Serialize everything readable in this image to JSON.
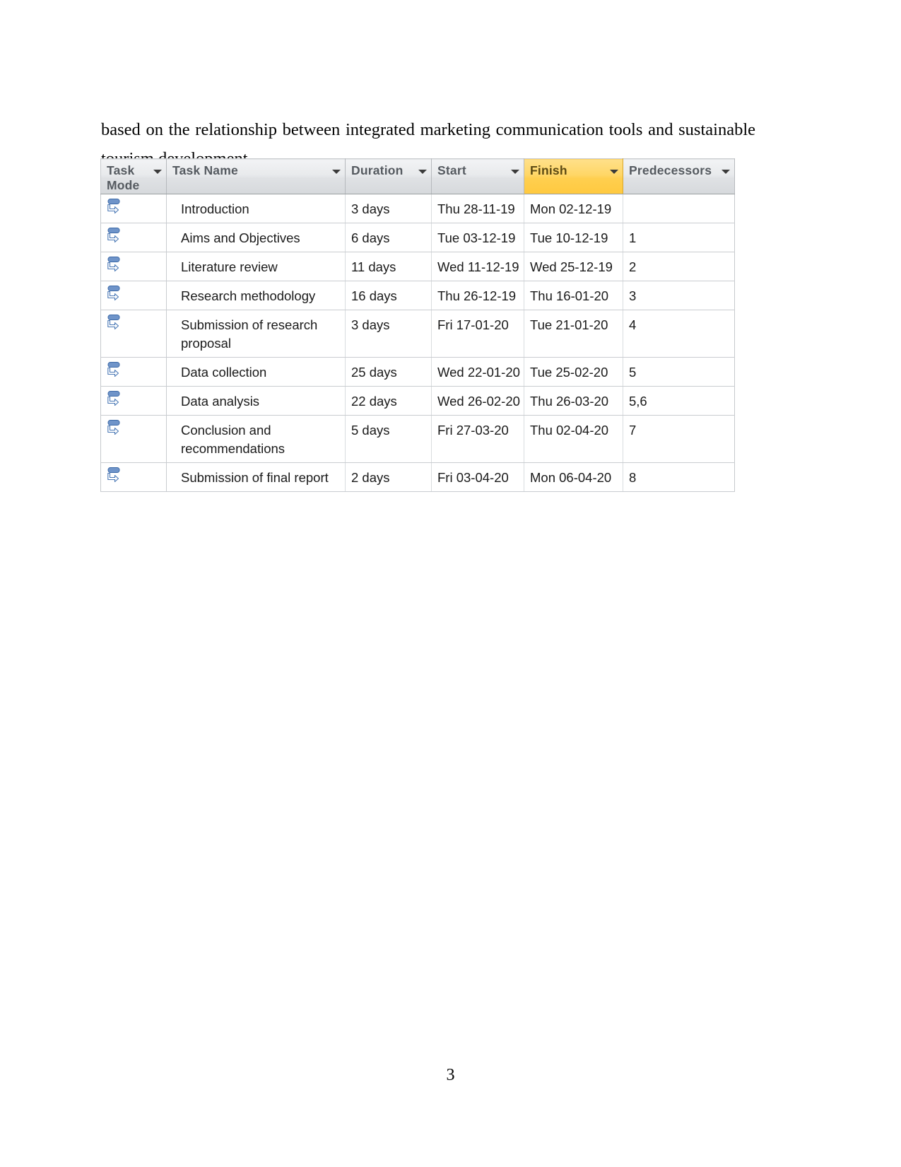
{
  "document": {
    "paragraph": "based on the relationship between integrated marketing communication tools and sustainable tourism development.",
    "page_number": "3"
  },
  "project_table": {
    "columns": [
      {
        "label": "Task\nMode",
        "key": "task_mode",
        "highlight": false,
        "caret": "chevron-down-icon"
      },
      {
        "label": "Task Name",
        "key": "task_name",
        "highlight": false,
        "caret": "chevron-down-icon"
      },
      {
        "label": "Duration",
        "key": "duration",
        "highlight": false,
        "caret": "chevron-down-icon"
      },
      {
        "label": "Start",
        "key": "start",
        "highlight": false,
        "caret": "chevron-down-icon"
      },
      {
        "label": "Finish",
        "key": "finish",
        "highlight": true,
        "caret": "chevron-down-icon"
      },
      {
        "label": "Predecessors",
        "key": "predecessors",
        "highlight": false,
        "caret": "chevron-down-icon"
      }
    ],
    "highlight_color": "#FFD666",
    "header_color": "#E4E6E9",
    "rows": [
      {
        "task_mode": "manually-scheduled-icon",
        "task_name": "Introduction",
        "duration": "3 days",
        "start": "Thu 28-11-19",
        "finish": "Mon 02-12-19",
        "predecessors": ""
      },
      {
        "task_mode": "manually-scheduled-icon",
        "task_name": "Aims and Objectives",
        "duration": "6 days",
        "start": "Tue 03-12-19",
        "finish": "Tue 10-12-19",
        "predecessors": "1"
      },
      {
        "task_mode": "manually-scheduled-icon",
        "task_name": "Literature review",
        "duration": "11 days",
        "start": "Wed 11-12-19",
        "finish": "Wed 25-12-19",
        "predecessors": "2"
      },
      {
        "task_mode": "manually-scheduled-icon",
        "task_name": "Research methodology",
        "duration": "16 days",
        "start": "Thu 26-12-19",
        "finish": "Thu 16-01-20",
        "predecessors": "3"
      },
      {
        "task_mode": "manually-scheduled-icon",
        "task_name": "Submission of research proposal",
        "duration": "3 days",
        "start": "Fri 17-01-20",
        "finish": "Tue 21-01-20",
        "predecessors": "4"
      },
      {
        "task_mode": "manually-scheduled-icon",
        "task_name": "Data collection",
        "duration": "25 days",
        "start": "Wed 22-01-20",
        "finish": "Tue 25-02-20",
        "predecessors": "5"
      },
      {
        "task_mode": "manually-scheduled-icon",
        "task_name": "Data analysis",
        "duration": "22 days",
        "start": "Wed 26-02-20",
        "finish": "Thu 26-03-20",
        "predecessors": "5,6"
      },
      {
        "task_mode": "manually-scheduled-icon",
        "task_name": "Conclusion and recommendations",
        "duration": "5 days",
        "start": "Fri 27-03-20",
        "finish": "Thu 02-04-20",
        "predecessors": "7"
      },
      {
        "task_mode": "manually-scheduled-icon",
        "task_name": "Submission of final report",
        "duration": "2 days",
        "start": "Fri 03-04-20",
        "finish": "Mon 06-04-20",
        "predecessors": "8"
      }
    ]
  }
}
